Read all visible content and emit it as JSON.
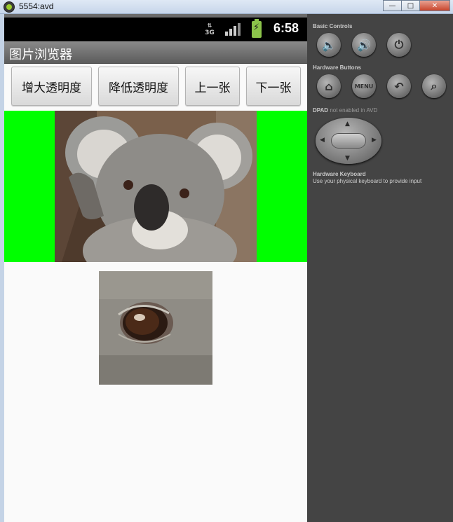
{
  "window": {
    "title": "5554:avd",
    "minimize": "—",
    "maximize": "□",
    "close": "✕"
  },
  "statusbar": {
    "network": "3G",
    "time": "6:58"
  },
  "app": {
    "title": "图片浏览器",
    "buttons": {
      "increase_alpha": "增大透明度",
      "decrease_alpha": "降低透明度",
      "prev": "上一张",
      "next": "下一张"
    },
    "colors": {
      "image_background": "#00ff00"
    }
  },
  "emulator_panel": {
    "basic_controls_label": "Basic Controls",
    "hardware_buttons_label": "Hardware Buttons",
    "menu_label": "MENU",
    "dpad_label": "DPAD",
    "dpad_note": "not enabled in AVD",
    "keyboard_label": "Hardware Keyboard",
    "keyboard_note": "Use your physical keyboard to provide input"
  }
}
